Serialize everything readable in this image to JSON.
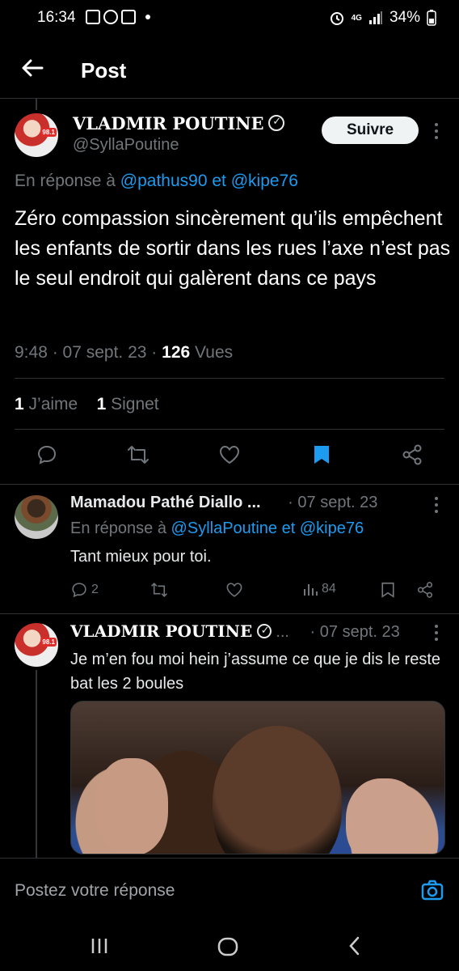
{
  "status_bar": {
    "time": "16:34",
    "network": "4G",
    "battery": "34%"
  },
  "header": {
    "title": "Post"
  },
  "main_post": {
    "author_name": "VLADMIR POUTINE",
    "handle": "@SyllaPoutine",
    "follow_label": "Suivre",
    "reply_prefix": "En réponse à",
    "reply_user1": "@pathus90",
    "reply_and": "et",
    "reply_user2": "@kipe76",
    "text": "Zéro compassion sincèrement qu’ils empêchent les enfants de sortir dans les rues l’axe n’est pas le seul endroit qui galèrent dans ce pays",
    "time": "9:48",
    "date": "07 sept. 23",
    "views_count": "126",
    "views_label": "Vues",
    "likes_count": "1",
    "likes_label": "J’aime",
    "bookmarks_count": "1",
    "bookmarks_label": "Signet",
    "avatar_badge": "98.1"
  },
  "reply1": {
    "author_name": "Mamadou Pathé Diallo ...",
    "date": "· 07 sept. 23",
    "reply_prefix": "En réponse à",
    "reply_user1": "@SyllaPoutine",
    "reply_and": "et",
    "reply_user2": "@kipe76",
    "text": "Tant mieux pour toi.",
    "replies": "2",
    "views": "84"
  },
  "reply2": {
    "author_name": "VLADMIR POUTINE",
    "ellipsis": "...",
    "date": "· 07 sept. 23",
    "text": "Je m’en fou moi hein j’assume ce que je dis le reste bat les 2 boules",
    "avatar_badge": "98.1"
  },
  "composer": {
    "placeholder": "Postez votre réponse"
  },
  "colors": {
    "accent": "#1d9bf0",
    "muted": "#71767b",
    "background": "#000000"
  }
}
